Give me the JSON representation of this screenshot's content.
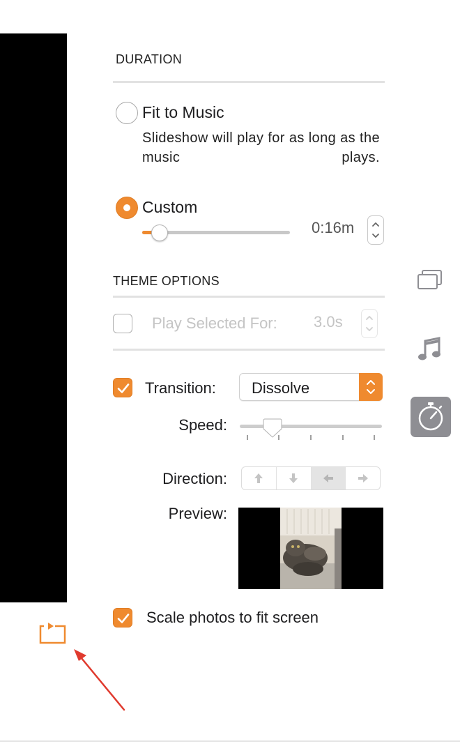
{
  "duration": {
    "title": "DURATION",
    "fit_to_music": {
      "label": "Fit to Music",
      "description": "Slideshow will play for as long as the music plays.",
      "selected": false
    },
    "custom": {
      "label": "Custom",
      "selected": true,
      "value": "0:16m",
      "slider_fraction": 0.12
    }
  },
  "theme_options": {
    "title": "THEME OPTIONS",
    "play_selected": {
      "label": "Play Selected For:",
      "value": "3.0s",
      "checked": false,
      "enabled": false
    },
    "transition": {
      "label": "Transition:",
      "checked": true,
      "selected": "Dissolve"
    },
    "speed": {
      "label": "Speed:",
      "slider_fraction": 0.24
    },
    "direction": {
      "label": "Direction:",
      "options": [
        "up",
        "down",
        "left",
        "right"
      ],
      "selected": "left"
    },
    "preview": {
      "label": "Preview:"
    },
    "scale_photos": {
      "label": "Scale photos to fit screen",
      "checked": true
    }
  },
  "sidebar_tabs": [
    {
      "icon": "themes-icon",
      "selected": false
    },
    {
      "icon": "music-note-icon",
      "selected": false
    },
    {
      "icon": "stopwatch-icon",
      "selected": true
    }
  ],
  "bottom": {
    "icon": "loop-icon"
  },
  "colors": {
    "accent": "#ef8a2f",
    "annotation_arrow": "#e03a2e",
    "selected_tab": "#8e8e93"
  }
}
